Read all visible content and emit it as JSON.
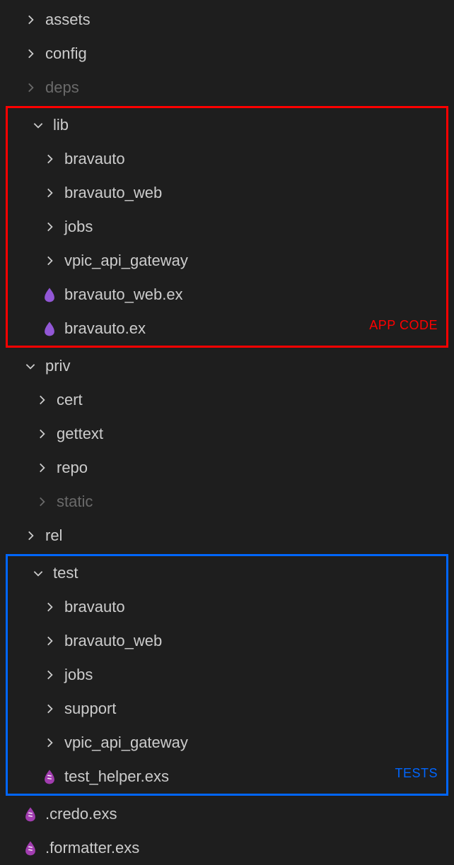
{
  "annotations": {
    "lib_label": "APP CODE",
    "test_label": "TESTS"
  },
  "colors": {
    "box_red": "#ff0000",
    "box_blue": "#0066ff",
    "elixir_purple": "#9257d6",
    "elixir_script": "#9c27b0"
  },
  "tree": {
    "assets": {
      "label": "assets"
    },
    "config": {
      "label": "config"
    },
    "deps": {
      "label": "deps"
    },
    "lib": {
      "label": "lib",
      "children": {
        "bravauto": {
          "label": "bravauto"
        },
        "bravauto_web": {
          "label": "bravauto_web"
        },
        "jobs": {
          "label": "jobs"
        },
        "vpic_api_gateway": {
          "label": "vpic_api_gateway"
        },
        "bravauto_web_ex": {
          "label": "bravauto_web.ex"
        },
        "bravauto_ex": {
          "label": "bravauto.ex"
        }
      }
    },
    "priv": {
      "label": "priv",
      "children": {
        "cert": {
          "label": "cert"
        },
        "gettext": {
          "label": "gettext"
        },
        "repo": {
          "label": "repo"
        },
        "static": {
          "label": "static"
        }
      }
    },
    "rel": {
      "label": "rel"
    },
    "test": {
      "label": "test",
      "children": {
        "bravauto": {
          "label": "bravauto"
        },
        "bravauto_web": {
          "label": "bravauto_web"
        },
        "jobs": {
          "label": "jobs"
        },
        "support": {
          "label": "support"
        },
        "vpic_api_gateway": {
          "label": "vpic_api_gateway"
        },
        "test_helper_exs": {
          "label": "test_helper.exs"
        }
      }
    },
    "credo_exs": {
      "label": ".credo.exs"
    },
    "formatter_exs": {
      "label": ".formatter.exs"
    }
  }
}
